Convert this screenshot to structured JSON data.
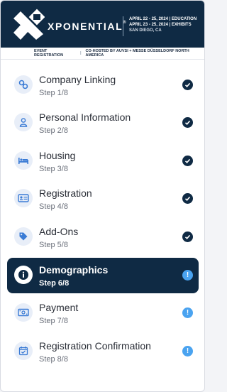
{
  "header": {
    "brand": "XPONENTIAL",
    "trademark": "®",
    "line1": "APRIL 22 - 25, 2024 | EDUCATION",
    "line2": "APRIL 23 - 25, 2024 | EXHIBITS",
    "location": "SAN DIEGO, CA",
    "sub_left": "EVENT REGISTRATION",
    "sub_sep": "|",
    "sub_right": "CO-HOSTED BY AUVSI + MESSE DÜSSELDORF NORTH AMERICA"
  },
  "colors": {
    "navy": "#0f2a44",
    "accent": "#4aa3f0",
    "icon_bg": "#e8eef8"
  },
  "steps": [
    {
      "title": "Company Linking",
      "sub": "Step 1/8",
      "icon": "link-icon",
      "status": "complete"
    },
    {
      "title": "Personal Information",
      "sub": "Step 2/8",
      "icon": "person-icon",
      "status": "complete"
    },
    {
      "title": "Housing",
      "sub": "Step 3/8",
      "icon": "bed-icon",
      "status": "complete"
    },
    {
      "title": "Registration",
      "sub": "Step 4/8",
      "icon": "id-card-icon",
      "status": "complete"
    },
    {
      "title": "Add-Ons",
      "sub": "Step 5/8",
      "icon": "tag-icon",
      "status": "complete"
    },
    {
      "title": "Demographics",
      "sub": "Step 6/8",
      "icon": "info-icon",
      "status": "pending",
      "active": true
    },
    {
      "title": "Payment",
      "sub": "Step 7/8",
      "icon": "money-icon",
      "status": "pending"
    },
    {
      "title": "Registration Confirmation",
      "sub": "Step 8/8",
      "icon": "calendar-check-icon",
      "status": "pending"
    }
  ],
  "status_marks": {
    "pending": "!"
  }
}
